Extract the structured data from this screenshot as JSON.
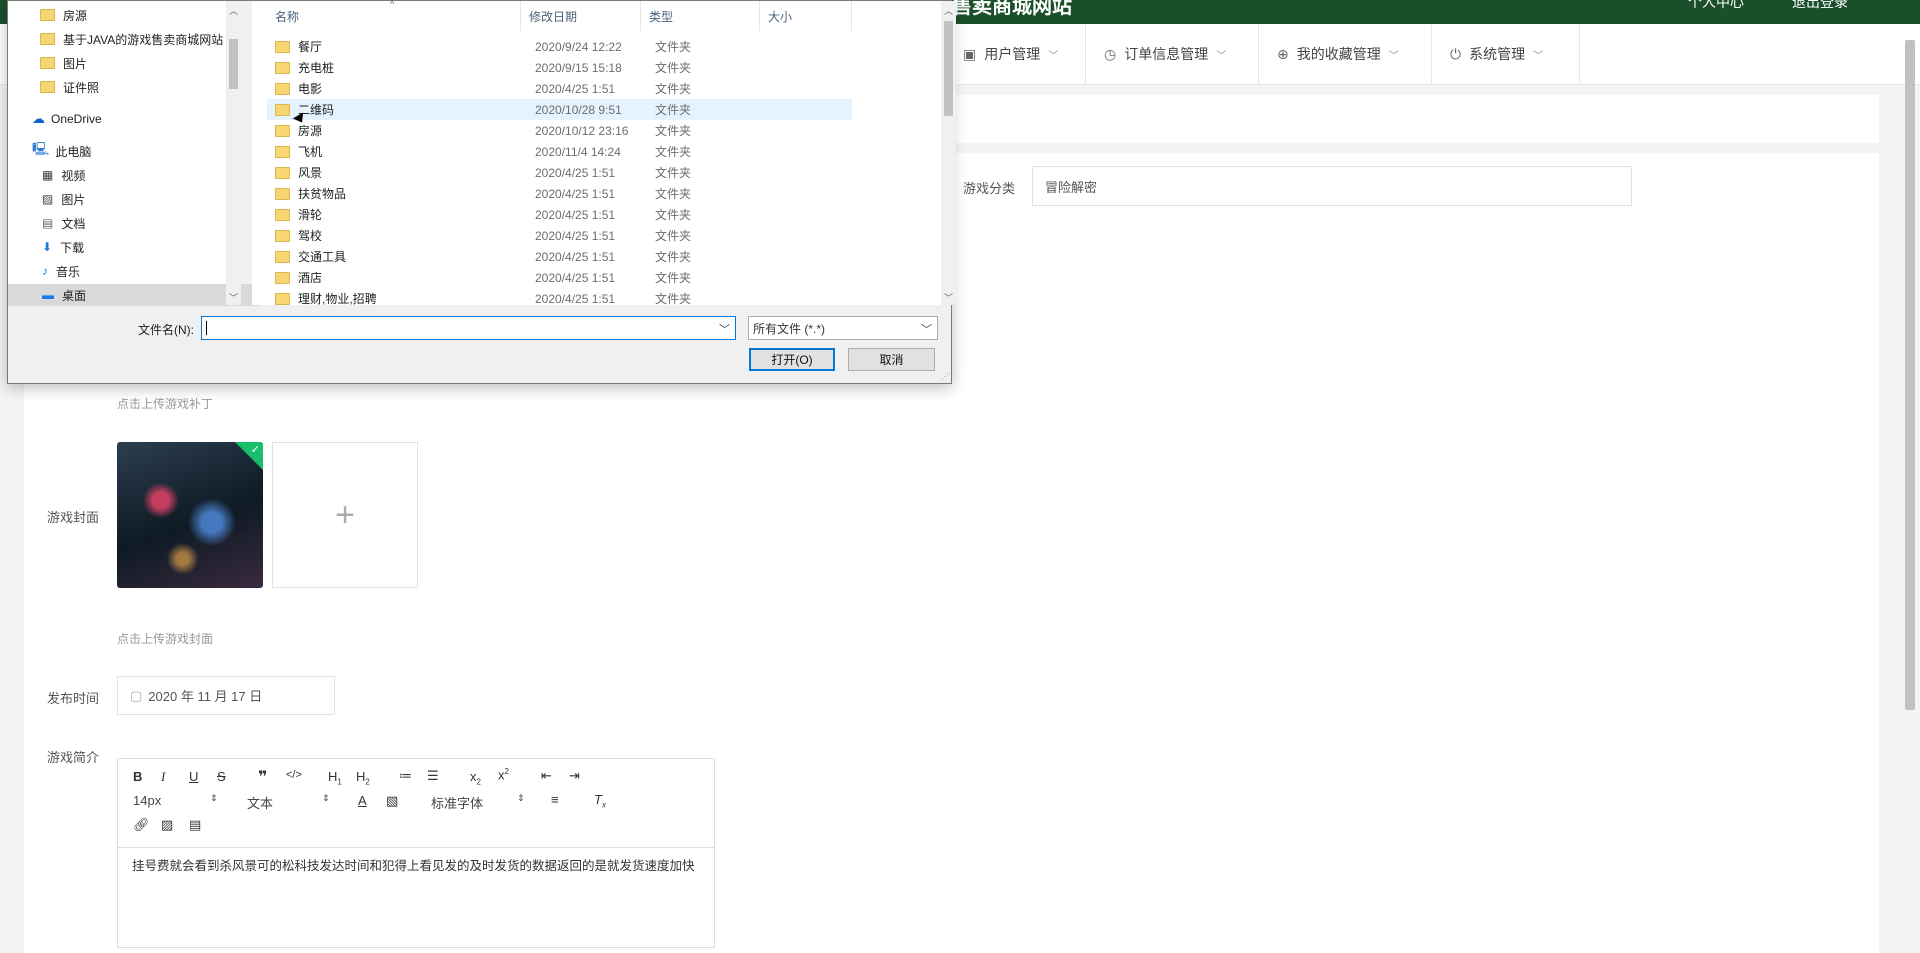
{
  "app": {
    "site_title": "售卖商城网站",
    "top_links": [
      "个人中心",
      "退出登录"
    ]
  },
  "nav": [
    {
      "label": "用户管理",
      "icon": "wallet-icon"
    },
    {
      "label": "订单信息管理",
      "icon": "clock-icon"
    },
    {
      "label": "我的收藏管理",
      "icon": "target-icon"
    },
    {
      "label": "系统管理",
      "icon": "power-icon"
    }
  ],
  "form": {
    "category_label": "游戏分类",
    "category_value": "冒险解密",
    "patch_hint": "点击上传游戏补丁",
    "cover_label": "游戏封面",
    "cover_hint": "点击上传游戏封面",
    "date_label": "发布时间",
    "date_value": "2020 年 11 月 17 日",
    "intro_label": "游戏简介",
    "editor": {
      "font_size": "14px",
      "block_format": "文本",
      "font_family": "标准字体",
      "content": "挂号费就会看到杀风景可的松科技发达时间和犯得上看见发的及时发货的数据返回的是就发货速度加快"
    }
  },
  "dialog": {
    "tree": [
      {
        "label": "房源",
        "icon": "folder-icon"
      },
      {
        "label": "基于JAVA的游戏售卖商城网站",
        "icon": "folder-icon"
      },
      {
        "label": "图片",
        "icon": "folder-icon"
      },
      {
        "label": "证件照",
        "icon": "folder-icon"
      },
      {
        "label": "OneDrive",
        "icon": "cloud-icon"
      },
      {
        "label": "此电脑",
        "icon": "computer-icon"
      },
      {
        "label": "视频",
        "icon": "video-icon"
      },
      {
        "label": "图片",
        "icon": "image-icon"
      },
      {
        "label": "文档",
        "icon": "document-icon"
      },
      {
        "label": "下载",
        "icon": "download-icon"
      },
      {
        "label": "音乐",
        "icon": "music-icon"
      },
      {
        "label": "桌面",
        "icon": "desktop-icon"
      }
    ],
    "columns": {
      "name": "名称",
      "date": "修改日期",
      "type": "类型",
      "size": "大小"
    },
    "files": [
      {
        "name": "餐厅",
        "date": "2020/9/24 12:22",
        "type": "文件夹"
      },
      {
        "name": "充电桩",
        "date": "2020/9/15 15:18",
        "type": "文件夹"
      },
      {
        "name": "电影",
        "date": "2020/4/25 1:51",
        "type": "文件夹"
      },
      {
        "name": "二维码",
        "date": "2020/10/28 9:51",
        "type": "文件夹"
      },
      {
        "name": "房源",
        "date": "2020/10/12 23:16",
        "type": "文件夹"
      },
      {
        "name": "飞机",
        "date": "2020/11/4 14:24",
        "type": "文件夹"
      },
      {
        "name": "风景",
        "date": "2020/4/25 1:51",
        "type": "文件夹"
      },
      {
        "name": "扶贫物品",
        "date": "2020/4/25 1:51",
        "type": "文件夹"
      },
      {
        "name": "滑轮",
        "date": "2020/4/25 1:51",
        "type": "文件夹"
      },
      {
        "name": "驾校",
        "date": "2020/4/25 1:51",
        "type": "文件夹"
      },
      {
        "name": "交通工具",
        "date": "2020/4/25 1:51",
        "type": "文件夹"
      },
      {
        "name": "酒店",
        "date": "2020/4/25 1:51",
        "type": "文件夹"
      },
      {
        "name": "理财,物业,招聘",
        "date": "2020/4/25 1:51",
        "type": "文件夹"
      }
    ],
    "filename_label": "文件名(N):",
    "filename_value": "",
    "filter_value": "所有文件 (*.*)",
    "open_button": "打开(O)",
    "cancel_button": "取消"
  }
}
